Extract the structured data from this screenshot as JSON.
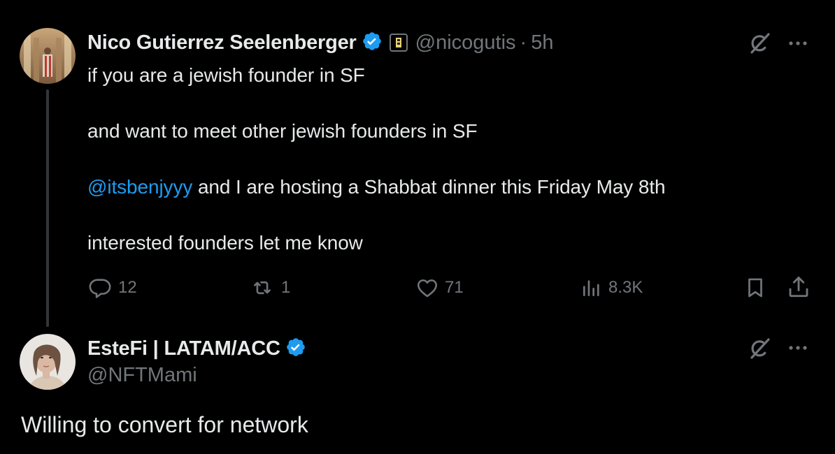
{
  "tweet": {
    "author_name": "Nico Gutierrez Seelenberger",
    "author_handle": "@nicogutis",
    "separator": "·",
    "time": "5h",
    "lines": [
      "if you are a jewish founder in SF",
      "and want to meet other jewish founders in SF",
      "interested founders let me know"
    ],
    "mention": "@itsbenjyyy",
    "mention_line_rest": " and I are hosting a Shabbat dinner this Friday May 8th",
    "stats": {
      "replies": "12",
      "reposts": "1",
      "likes": "71",
      "views": "8.3K"
    }
  },
  "reply": {
    "author_name": "EsteFi | LATAM/ACC",
    "author_handle": "@NFTMami",
    "text": "Willing to convert for network"
  },
  "colors": {
    "background": "#000000",
    "text": "#e7e9ea",
    "muted": "#71767b",
    "link": "#1d9bf0",
    "verified": "#1d9bf0"
  },
  "icons": [
    "grok-icon",
    "more-icon",
    "reply-icon",
    "repost-icon",
    "like-icon",
    "views-icon",
    "bookmark-icon",
    "share-icon",
    "verified-badge-icon",
    "affiliate-badge-icon"
  ]
}
